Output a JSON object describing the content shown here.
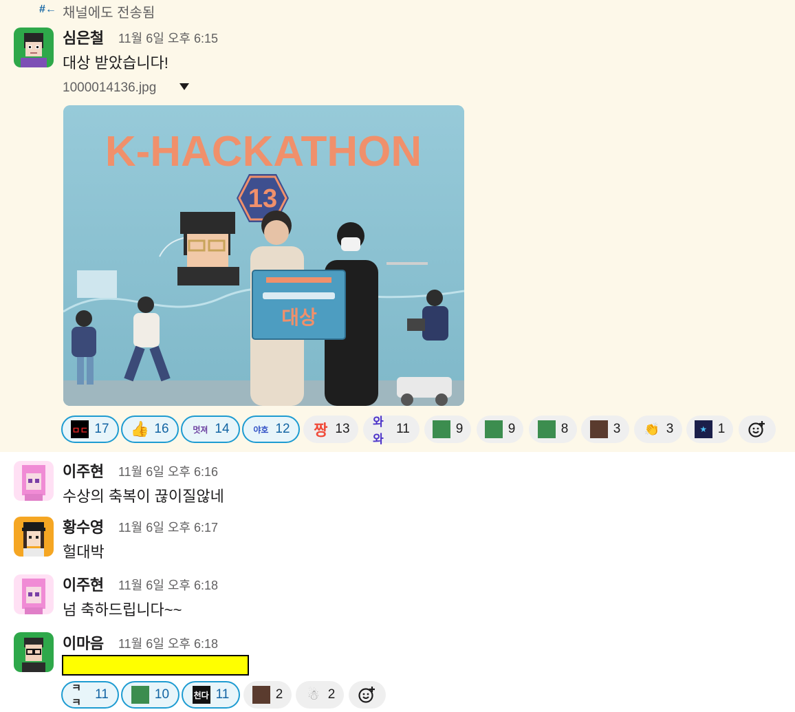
{
  "sent_note": {
    "icon": "hash-return-icon",
    "label": "채널에도 전송됨"
  },
  "messages": [
    {
      "name": "심은철",
      "time": "11월 6일 오후 6:15",
      "text": "대상 받았습니다!",
      "file": "1000014136.jpg",
      "photo": {
        "banner_title": "K-HACKATHON",
        "badge_number": "13",
        "sign_text": "대상"
      },
      "reactions": [
        {
          "emoji": "ㅁㄷ",
          "count": "17",
          "reacted": true
        },
        {
          "emoji": "👍",
          "count": "16",
          "reacted": true
        },
        {
          "emoji": "멋져",
          "count": "14",
          "reacted": true
        },
        {
          "emoji": "야호",
          "count": "12",
          "reacted": true
        },
        {
          "emoji": "짱",
          "count": "13",
          "reacted": false
        },
        {
          "emoji": "와와",
          "count": "11",
          "reacted": false
        },
        {
          "emoji": "face-icon",
          "count": "9",
          "reacted": false
        },
        {
          "emoji": "face-icon",
          "count": "9",
          "reacted": false
        },
        {
          "emoji": "face-icon",
          "count": "8",
          "reacted": false
        },
        {
          "emoji": "face-icon",
          "count": "3",
          "reacted": false
        },
        {
          "emoji": "👏",
          "count": "3",
          "reacted": false
        },
        {
          "emoji": "star-icon",
          "count": "1",
          "reacted": false
        }
      ]
    },
    {
      "name": "이주현",
      "time": "11월 6일 오후 6:16",
      "text": "수상의 축복이 끊이질않네"
    },
    {
      "name": "황수영",
      "time": "11월 6일 오후 6:17",
      "text": "헐대박"
    },
    {
      "name": "이주현",
      "time": "11월 6일 오후 6:18",
      "text": "넘 축하드립니다~~"
    },
    {
      "name": "이마음",
      "time": "11월 6일 오후 6:18",
      "text": "",
      "reactions": [
        {
          "emoji": "ㅋㅋ",
          "count": "11",
          "reacted": true
        },
        {
          "emoji": "face-icon",
          "count": "10",
          "reacted": true
        },
        {
          "emoji": "천다",
          "count": "11",
          "reacted": true
        },
        {
          "emoji": "face-icon",
          "count": "2",
          "reacted": false
        },
        {
          "emoji": "ghost-icon",
          "count": "2",
          "reacted": false
        }
      ]
    }
  ],
  "colors": {
    "highlight": "#fdf8e9",
    "reaction_active_border": "#1d9bd1",
    "reaction_active_bg": "#e8f5fa",
    "redaction": "#ffff00"
  }
}
